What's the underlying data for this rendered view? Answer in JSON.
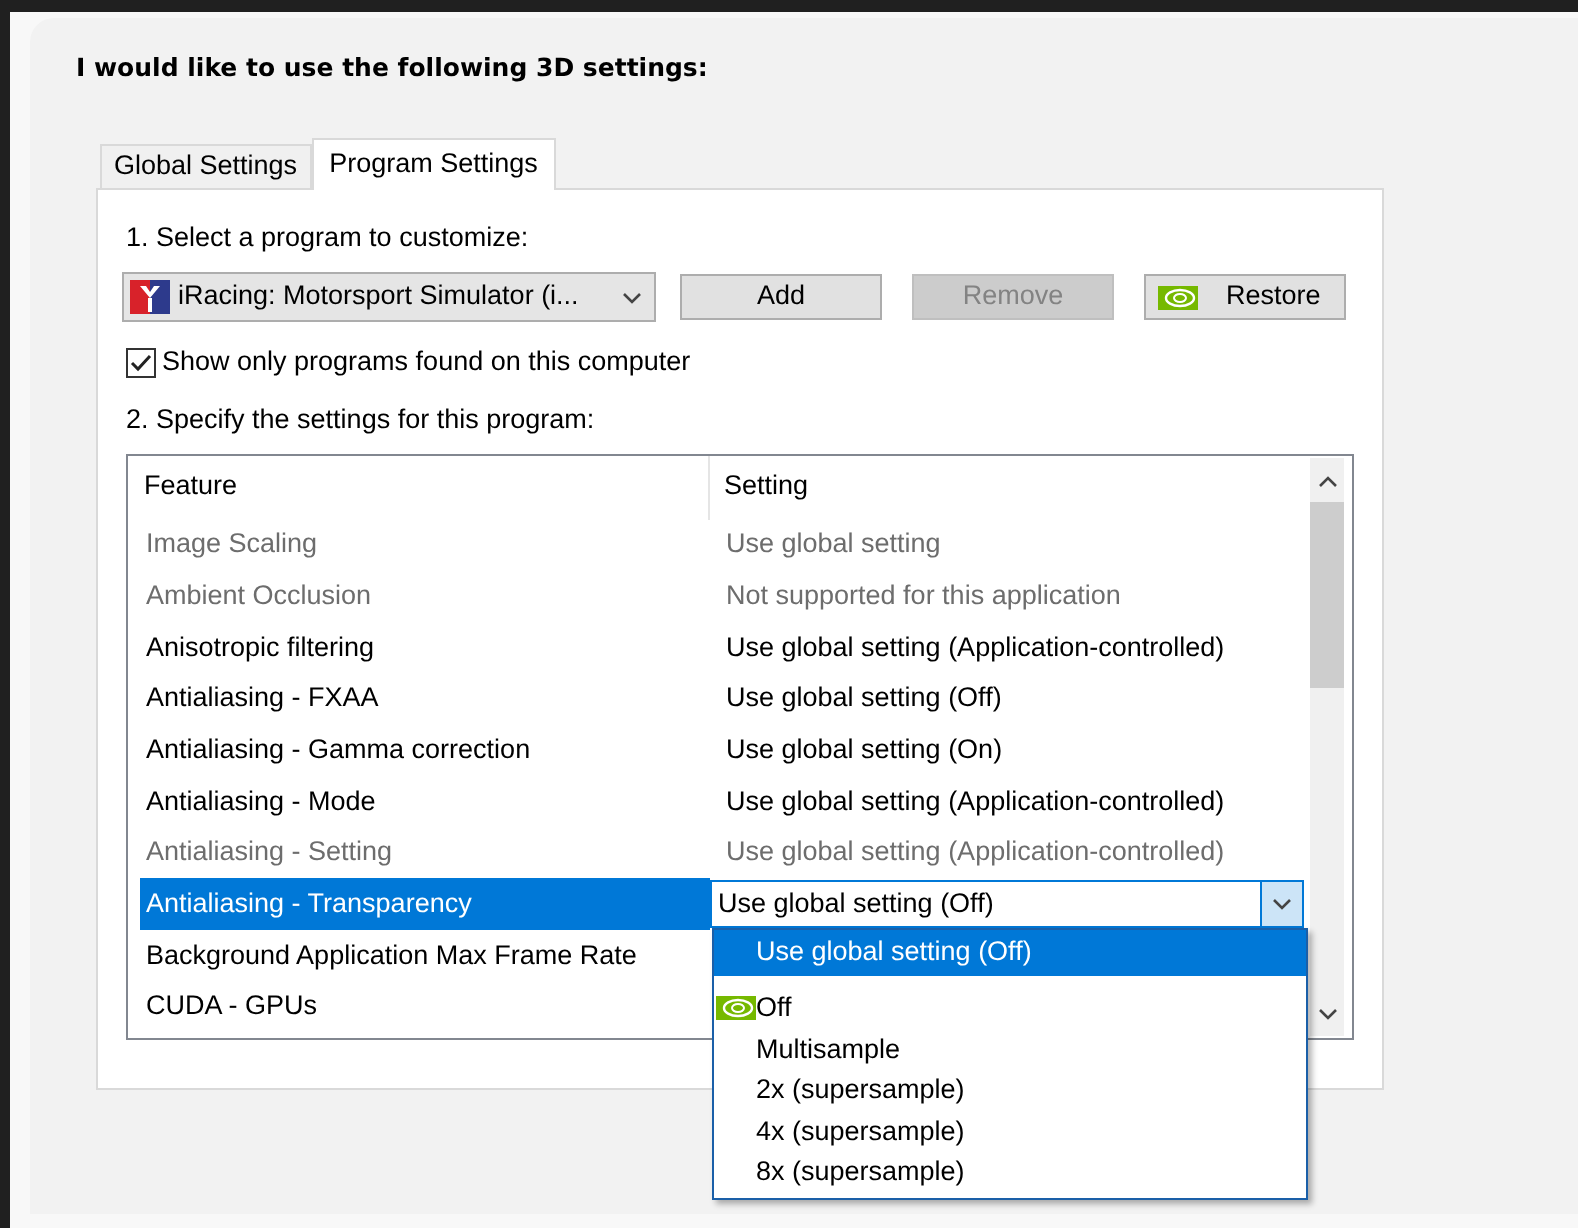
{
  "title": "I would like to use the following 3D settings:",
  "tabs": [
    {
      "label": "Global Settings",
      "selected": false
    },
    {
      "label": "Program Settings",
      "selected": true
    }
  ],
  "program_label": "1. Select a program to customize:",
  "program_select": {
    "value": "iRacing: Motorsport Simulator (i..."
  },
  "buttons": [
    {
      "label": "Add",
      "disabled": false,
      "icon": false
    },
    {
      "label": "Remove",
      "disabled": true,
      "icon": false
    },
    {
      "label": "Restore",
      "disabled": false,
      "icon": true
    }
  ],
  "checkbox": {
    "label": "Show only programs found on this computer",
    "checked": true
  },
  "settings_label": "2. Specify the settings for this program:",
  "table": {
    "columns": [
      "Feature",
      "Setting"
    ],
    "rows": [
      {
        "feature": "Image Scaling",
        "setting": "Use global setting",
        "disabled": true,
        "selected": false
      },
      {
        "feature": "Ambient Occlusion",
        "setting": "Not supported for this application",
        "disabled": true,
        "selected": false
      },
      {
        "feature": "Anisotropic filtering",
        "setting": "Use global setting (Application-controlled)",
        "disabled": false,
        "selected": false
      },
      {
        "feature": "Antialiasing - FXAA",
        "setting": "Use global setting (Off)",
        "disabled": false,
        "selected": false
      },
      {
        "feature": "Antialiasing - Gamma correction",
        "setting": "Use global setting (On)",
        "disabled": false,
        "selected": false
      },
      {
        "feature": "Antialiasing - Mode",
        "setting": "Use global setting (Application-controlled)",
        "disabled": false,
        "selected": false
      },
      {
        "feature": "Antialiasing - Setting",
        "setting": "Use global setting (Application-controlled)",
        "disabled": true,
        "selected": false
      },
      {
        "feature": "Antialiasing - Transparency",
        "setting": "Use global setting (Off)",
        "disabled": false,
        "selected": true
      },
      {
        "feature": "Background Application Max Frame Rate",
        "disabled": false,
        "selected": false
      },
      {
        "feature": "CUDA - GPUs",
        "disabled": false,
        "selected": false
      }
    ]
  },
  "dropdown": {
    "options": [
      {
        "label": "Use global setting (Off)",
        "selected": true,
        "icon": false
      },
      {
        "label": "Off",
        "selected": false,
        "icon": true
      },
      {
        "label": "Multisample",
        "selected": false,
        "icon": false
      },
      {
        "label": "2x (supersample)",
        "selected": false,
        "icon": false
      },
      {
        "label": "4x (supersample)",
        "selected": false,
        "icon": false
      },
      {
        "label": "8x (supersample)",
        "selected": false,
        "icon": false
      }
    ]
  }
}
